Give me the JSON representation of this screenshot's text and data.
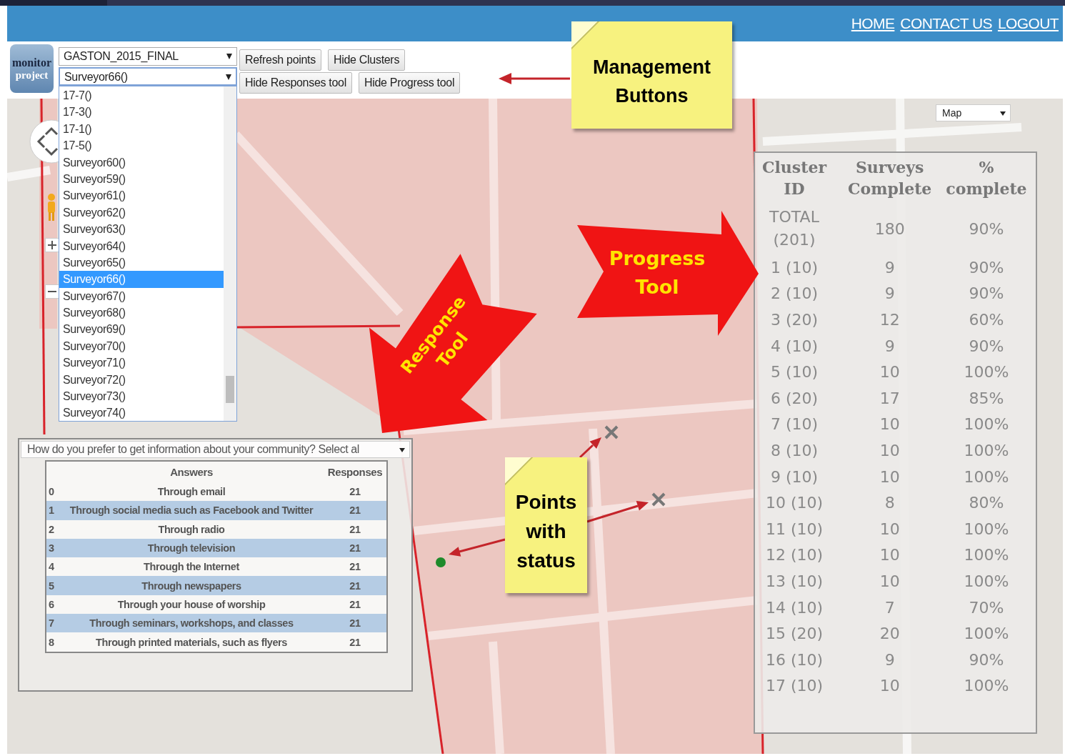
{
  "header": {
    "nav_links": [
      "HOME",
      "CONTACT US",
      "LOGOUT"
    ]
  },
  "logo": {
    "line_1": "monitor",
    "line_2": "project"
  },
  "toolbar": {
    "project_select": "GASTON_2015_FINAL",
    "surveyor_select": "Surveyor66()",
    "buttons": [
      [
        "Refresh points",
        "Hide Clusters"
      ],
      [
        "Hide Responses tool",
        "Hide Progress tool"
      ]
    ]
  },
  "surveyor_dropdown": {
    "items": [
      {
        "label": "17-7()",
        "selected": false
      },
      {
        "label": "17-3()",
        "selected": false
      },
      {
        "label": "17-1()",
        "selected": false
      },
      {
        "label": "17-5()",
        "selected": false
      },
      {
        "label": "Surveyor60()",
        "selected": false
      },
      {
        "label": "Surveyor59()",
        "selected": false
      },
      {
        "label": "Surveyor61()",
        "selected": false
      },
      {
        "label": "Surveyor62()",
        "selected": false
      },
      {
        "label": "Surveyor63()",
        "selected": false
      },
      {
        "label": "Surveyor64()",
        "selected": false
      },
      {
        "label": "Surveyor65()",
        "selected": false
      },
      {
        "label": "Surveyor66()",
        "selected": true
      },
      {
        "label": "Surveyor67()",
        "selected": false
      },
      {
        "label": "Surveyor68()",
        "selected": false
      },
      {
        "label": "Surveyor69()",
        "selected": false
      },
      {
        "label": "Surveyor70()",
        "selected": false
      },
      {
        "label": "Surveyor71()",
        "selected": false
      },
      {
        "label": "Surveyor72()",
        "selected": false
      },
      {
        "label": "Surveyor73()",
        "selected": false
      },
      {
        "label": "Surveyor74()",
        "selected": false
      }
    ]
  },
  "map": {
    "type_select": "Map",
    "points": [
      {
        "kind": "cross",
        "color": "#777777"
      },
      {
        "kind": "cross",
        "color": "#777777"
      },
      {
        "kind": "dot",
        "color": "#1f8a2b"
      }
    ]
  },
  "response_tool": {
    "question": "How do you prefer to get information about your community? Select al",
    "columns": [
      "Answers",
      "Responses"
    ],
    "rows": [
      {
        "index": "0",
        "answer": "Through email",
        "responses": "21"
      },
      {
        "index": "1",
        "answer": "Through social media such as Facebook and Twitter",
        "responses": "21"
      },
      {
        "index": "2",
        "answer": "Through radio",
        "responses": "21"
      },
      {
        "index": "3",
        "answer": "Through television",
        "responses": "21"
      },
      {
        "index": "4",
        "answer": "Through the Internet",
        "responses": "21"
      },
      {
        "index": "5",
        "answer": "Through newspapers",
        "responses": "21"
      },
      {
        "index": "6",
        "answer": "Through your house of worship",
        "responses": "21"
      },
      {
        "index": "7",
        "answer": "Through seminars, workshops, and classes",
        "responses": "21"
      },
      {
        "index": "8",
        "answer": "Through printed materials, such as flyers",
        "responses": "21"
      }
    ]
  },
  "progress_tool": {
    "columns": [
      "Cluster ID",
      "Surveys Complete",
      "% complete"
    ],
    "rows": [
      {
        "cluster": "TOTAL (201)",
        "surveys": "180",
        "percent": "90%"
      },
      {
        "cluster": "1 (10)",
        "surveys": "9",
        "percent": "90%"
      },
      {
        "cluster": "2 (10)",
        "surveys": "9",
        "percent": "90%"
      },
      {
        "cluster": "3 (20)",
        "surveys": "12",
        "percent": "60%"
      },
      {
        "cluster": "4 (10)",
        "surveys": "9",
        "percent": "90%"
      },
      {
        "cluster": "5 (10)",
        "surveys": "10",
        "percent": "100%"
      },
      {
        "cluster": "6 (20)",
        "surveys": "17",
        "percent": "85%"
      },
      {
        "cluster": "7 (10)",
        "surveys": "10",
        "percent": "100%"
      },
      {
        "cluster": "8 (10)",
        "surveys": "10",
        "percent": "100%"
      },
      {
        "cluster": "9 (10)",
        "surveys": "10",
        "percent": "100%"
      },
      {
        "cluster": "10 (10)",
        "surveys": "8",
        "percent": "80%"
      },
      {
        "cluster": "11 (10)",
        "surveys": "10",
        "percent": "100%"
      },
      {
        "cluster": "12 (10)",
        "surveys": "10",
        "percent": "100%"
      },
      {
        "cluster": "13 (10)",
        "surveys": "10",
        "percent": "100%"
      },
      {
        "cluster": "14 (10)",
        "surveys": "7",
        "percent": "70%"
      },
      {
        "cluster": "15 (20)",
        "surveys": "20",
        "percent": "100%"
      },
      {
        "cluster": "16 (10)",
        "surveys": "9",
        "percent": "90%"
      },
      {
        "cluster": "17 (10)",
        "surveys": "10",
        "percent": "100%"
      }
    ]
  },
  "callouts": {
    "management_note": "Management Buttons",
    "progress_arrow": "Progress Tool",
    "response_arrow": "Response Tool",
    "points_note": "Points with status"
  }
}
